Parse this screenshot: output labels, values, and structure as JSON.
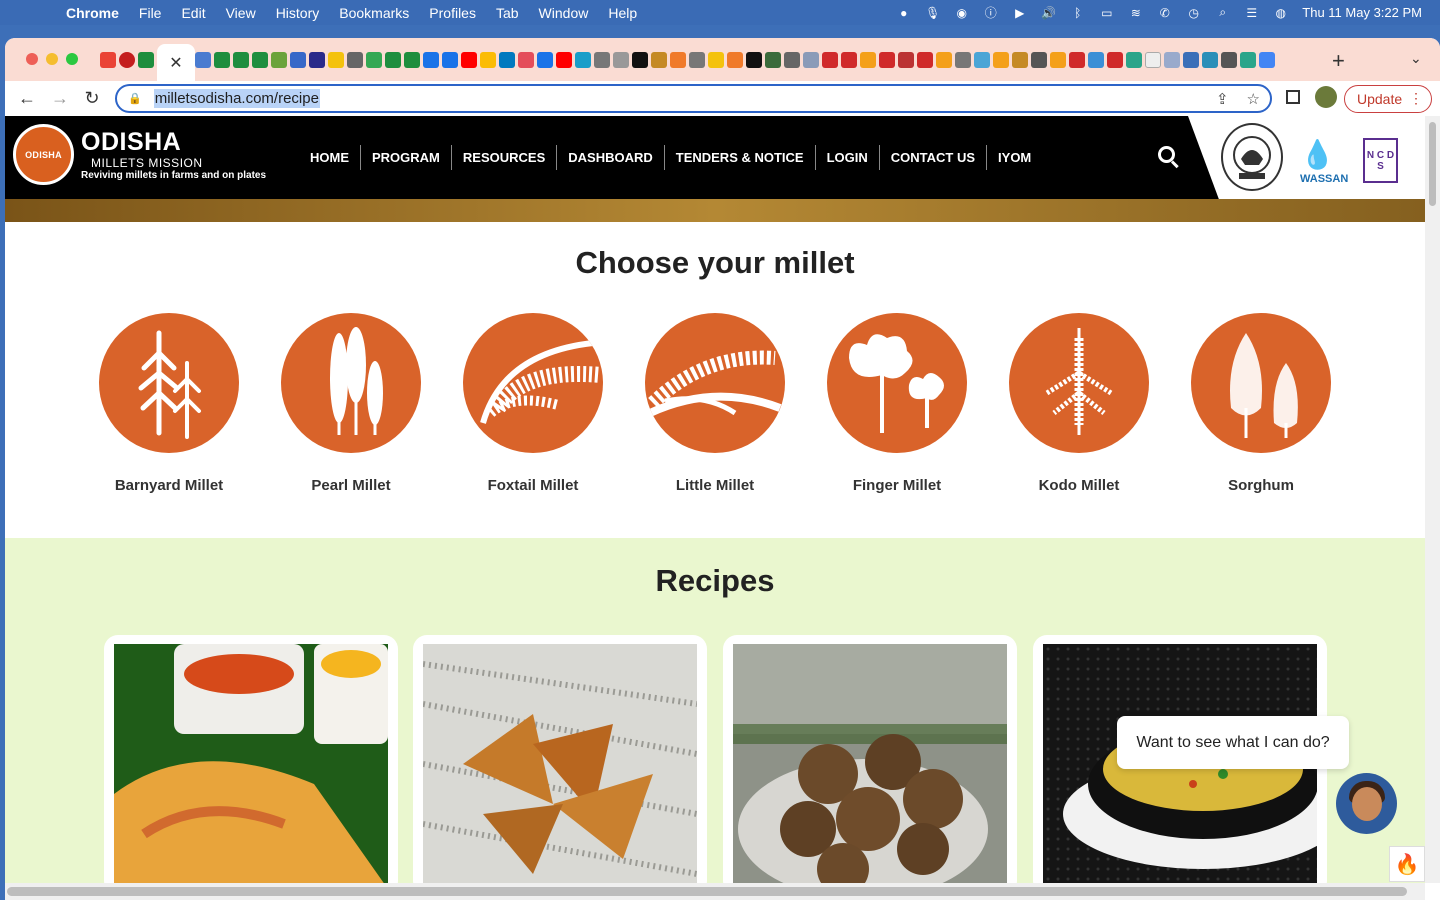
{
  "os_menubar": {
    "app": "Chrome",
    "menus": [
      "File",
      "Edit",
      "View",
      "History",
      "Bookmarks",
      "Profiles",
      "Tab",
      "Window",
      "Help"
    ],
    "datetime": "Thu 11 May  3:22 PM"
  },
  "browser": {
    "url": "milletsodisha.com/recipe",
    "update_label": "Update",
    "tab_close": "✕",
    "new_tab": "+"
  },
  "site": {
    "logo_text": "ODISHA",
    "brand_title": "ODISHA",
    "brand_subtitle": "MILLETS MISSION",
    "brand_tagline": "Reviving millets in farms and on plates",
    "nav": [
      "HOME",
      "PROGRAM",
      "RESOURCES",
      "DASHBOARD",
      "TENDERS & NOTICE",
      "LOGIN",
      "CONTACT US",
      "IYOM"
    ],
    "partners": {
      "wassan": "WASSAN",
      "ncds": "N C D S"
    }
  },
  "choose_section": {
    "title": "Choose your millet",
    "millets": [
      "Barnyard Millet",
      "Pearl Millet",
      "Foxtail Millet",
      "Little Millet",
      "Finger Millet",
      "Kodo Millet",
      "Sorghum"
    ]
  },
  "recipes_section": {
    "title": "Recipes"
  },
  "chat": {
    "prompt": "Want to see what I can do?"
  },
  "colors": {
    "millet_circle": "#d9632a",
    "recipes_bg": "#eaf7cf",
    "header_bg": "#000000",
    "accent_update": "#c0392b"
  }
}
